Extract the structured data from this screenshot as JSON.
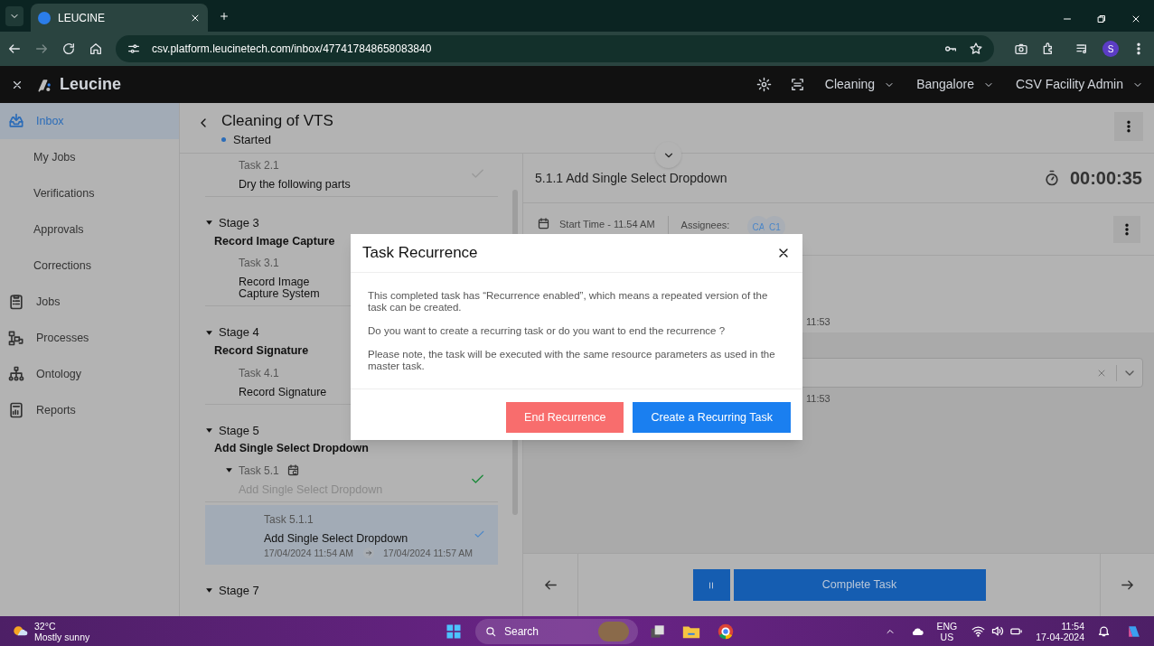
{
  "browser": {
    "tab_title": "LEUCINE",
    "url": "csv.platform.leucinetech.com/inbox/477417848658083840",
    "profile_initial": "S"
  },
  "app_header": {
    "logo": "Leucine",
    "dropdowns": [
      "Cleaning",
      "Bangalore",
      "CSV Facility Admin"
    ]
  },
  "sidebar": {
    "items": [
      {
        "label": "Inbox",
        "kind": "main",
        "selected": true
      },
      {
        "label": "My Jobs",
        "kind": "sub",
        "selected": false
      },
      {
        "label": "Verifications",
        "kind": "sub",
        "selected": false
      },
      {
        "label": "Approvals",
        "kind": "sub",
        "selected": false
      },
      {
        "label": "Corrections",
        "kind": "sub",
        "selected": false
      },
      {
        "label": "Jobs",
        "kind": "main",
        "selected": false
      },
      {
        "label": "Processes",
        "kind": "main",
        "selected": false
      },
      {
        "label": "Ontology",
        "kind": "main",
        "selected": false
      },
      {
        "label": "Reports",
        "kind": "main",
        "selected": false
      }
    ]
  },
  "job": {
    "title": "Cleaning of VTS",
    "status": "Started"
  },
  "stages": [
    {
      "tasks": [
        {
          "number": "Task 2.1",
          "title": "Dry the following parts",
          "color": "#9a9a9a",
          "selected": false
        }
      ]
    },
    {
      "label": "Stage 3",
      "title": "Record Image Capture",
      "expanded": true,
      "tasks": [
        {
          "number": "Task 3.1",
          "title": "Record Image Capture System",
          "selected": false
        }
      ]
    },
    {
      "label": "Stage 4",
      "title": "Record Signature",
      "expanded": true,
      "tasks": [
        {
          "number": "Task 4.1",
          "title": "Record Signature",
          "selected": false
        }
      ]
    },
    {
      "label": "Stage 5",
      "title": "Add Single Select Dropdown",
      "expanded": true,
      "tasks": [
        {
          "number": "Task 5.1",
          "title": "Add Single Select Dropdown",
          "color": "#1e8a3c",
          "recurring": true,
          "muted_title": true,
          "expanded": true,
          "selected": false,
          "children": [
            {
              "number": "Task 5.1.1",
              "title": "Add Single Select Dropdown",
              "color": "#4a86c8",
              "selected": true,
              "start": "17/04/2024 11:54 AM",
              "end": "17/04/2024 11:57 AM"
            }
          ]
        }
      ]
    },
    {
      "label": "Stage 7",
      "expanded": true
    }
  ],
  "task_panel": {
    "title": "5.1.1 Add Single Select Dropdown",
    "timer": "00:00:35",
    "start_time": "Start Time - 11.54 AM",
    "assignees_label": "Assignees:",
    "assignees": [
      "CA",
      "C1"
    ],
    "times": [
      "11:53",
      "11:53"
    ]
  },
  "footer": {
    "complete_label": "Complete Task"
  },
  "modal": {
    "title": "Task Recurrence",
    "paragraphs": [
      "This completed task has “Recurrence enabled”, which means a repeated version of the task can be created.",
      "Do you want to create a recurring task or do you want to end the recurrence ?",
      "Please note, the task will be executed with the same resource parameters as used in the master task."
    ],
    "buttons": [
      {
        "label": "End Recurrence",
        "kind": "danger"
      },
      {
        "label": "Create a Recurring Task",
        "kind": "primary"
      }
    ]
  },
  "taskbar": {
    "temperature": "32°C",
    "weather": "Mostly sunny",
    "search": "Search",
    "language": "ENG",
    "region": "US",
    "time": "11:54",
    "date": "17-04-2024"
  }
}
